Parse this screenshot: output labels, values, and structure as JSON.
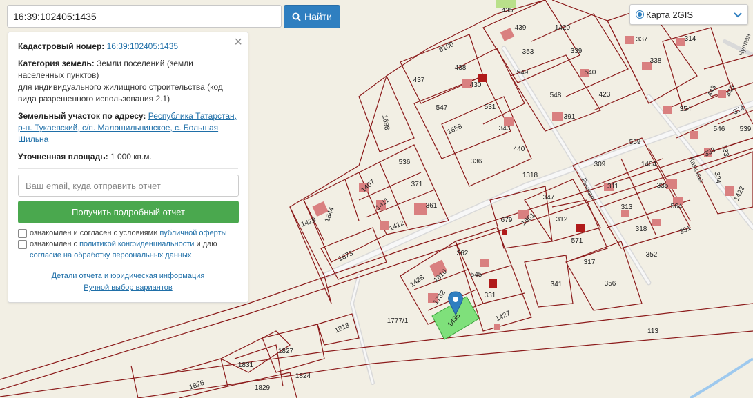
{
  "search": {
    "value": "16:39:102405:1435",
    "button_label": "Найти"
  },
  "layer": {
    "selected": "Карта 2GIS"
  },
  "panel": {
    "cadastral_label": "Кадастровый номер:",
    "cadastral_value": "16:39:102405:1435",
    "category_label": "Категория земель:",
    "category_value": "Земли поселений (земли населенных пунктов)",
    "usage_value": "для индивидуального жилищного строительства (код вида разрешенного использования 2.1)",
    "address_label": "Земельный участок по адресу:",
    "address_value": "Республика Татарстан, р-н. Тукаевский, с/п. Малошильнинское, с. Большая Шильна",
    "area_label": "Уточненная площадь:",
    "area_value": "1 000 кв.м.",
    "email_placeholder": "Ваш email, куда отправить отчет",
    "report_button": "Получить подробный отчет",
    "consent1_text": "ознакомлен и согласен с условиями",
    "consent1_link": "публичной оферты",
    "consent2_text": "ознакомлен с",
    "consent2_link": "политикой конфиденциальности",
    "consent2_and": "и даю",
    "consent2_link2": "согласие на обработку персональных данных",
    "details_link": "Детали отчета и юридическая информация",
    "manual_link": "Ручной выбор вариантов"
  },
  "map": {
    "streets": [
      "Речная",
      "Камская",
      "Чулпан"
    ],
    "plots": [
      "435",
      "439",
      "1420",
      "353",
      "339",
      "337",
      "314",
      "6100",
      "438",
      "430",
      "549",
      "540",
      "338",
      "437",
      "423",
      "443",
      "443",
      "547",
      "531",
      "548",
      "391",
      "354",
      "546",
      "374",
      "539",
      "1658",
      "343",
      "559",
      "333",
      "1698",
      "440",
      "333",
      "336",
      "1404",
      "309",
      "334",
      "1422",
      "1318",
      "311",
      "335",
      "1407",
      "536",
      "371",
      "347",
      "312",
      "313",
      "564",
      "1429",
      "1844",
      "1411",
      "361",
      "679",
      "1661",
      "318",
      "351",
      "1412",
      "571",
      "352",
      "1673",
      "362",
      "317",
      "1428",
      "1810",
      "545",
      "341",
      "356",
      "331",
      "1732",
      "1435",
      "1427",
      "1777/1",
      "1813",
      "113",
      "1831",
      "1827",
      "1824",
      "1825",
      "1829"
    ],
    "selected_plot": "1435"
  }
}
